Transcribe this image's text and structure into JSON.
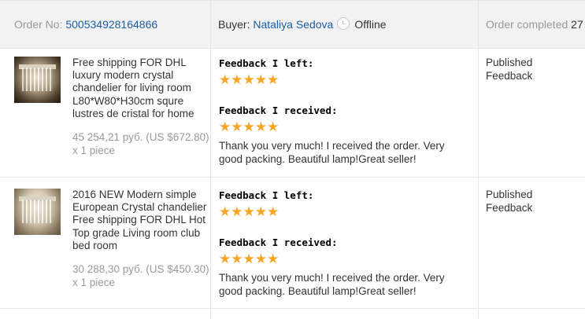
{
  "header": {
    "order_label": "Order No:",
    "order_number": "500534928164866",
    "buyer_label": "Buyer:",
    "buyer_name": "Nataliya Sedova",
    "buyer_status": "Offline",
    "order_status_label": "Order completed",
    "order_status_value": "27"
  },
  "items": [
    {
      "title": "Free shipping FOR DHL luxury modern crystal chandelier for living room L80*W80*H30cm squre lustres de cristal for home",
      "price": "45 254,21 руб. (US $672.80) x 1 piece",
      "feedback_left_label": "Feedback I left:",
      "feedback_left_stars": "★★★★★",
      "feedback_received_label": "Feedback I received:",
      "feedback_received_stars": "★★★★★",
      "feedback_received_text": "Thank you very much! I received the order. Very good packing. Beautiful lamp!Great seller!",
      "status": "Published Feedback"
    },
    {
      "title": "2016 NEW Modern simple European Crystal chandelier Free shipping FOR DHL Hot Top grade Living room club bed room",
      "price": "30 288,30 руб. (US $450.30) x 1 piece",
      "feedback_left_label": "Feedback I left:",
      "feedback_left_stars": "★★★★★",
      "feedback_received_label": "Feedback I received:",
      "feedback_received_stars": "★★★★★",
      "feedback_received_text": "Thank you very much! I received the order. Very good packing. Beautiful lamp!Great seller!",
      "status": "Published Feedback"
    }
  ],
  "colors": {
    "link": "#1a5ea8",
    "star": "#f5a623",
    "muted": "#999999",
    "header_bg": "#f2f2f2"
  }
}
